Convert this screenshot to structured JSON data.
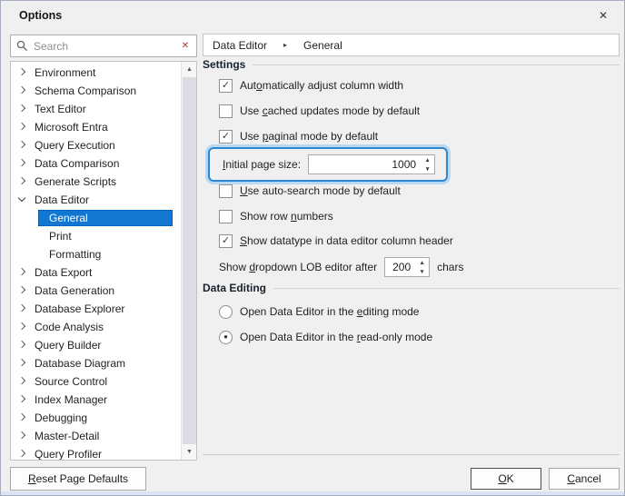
{
  "window": {
    "title": "Options",
    "close_glyph": "✕"
  },
  "search": {
    "placeholder": "Search",
    "clear_glyph": "✕"
  },
  "breadcrumb": {
    "items": [
      "Data Editor",
      "General"
    ],
    "separator_glyph": "▸"
  },
  "tree": {
    "scroll_up_glyph": "▲",
    "scroll_down_glyph": "▼",
    "items": [
      {
        "label": "Environment"
      },
      {
        "label": "Schema Comparison"
      },
      {
        "label": "Text Editor"
      },
      {
        "label": "Microsoft Entra"
      },
      {
        "label": "Query Execution"
      },
      {
        "label": "Data Comparison"
      },
      {
        "label": "Generate Scripts"
      },
      {
        "label": "Data Editor",
        "expanded": true
      },
      {
        "label": "General",
        "selected": true
      },
      {
        "label": "Print"
      },
      {
        "label": "Formatting"
      },
      {
        "label": "Data Export"
      },
      {
        "label": "Data Generation"
      },
      {
        "label": "Database Explorer"
      },
      {
        "label": "Code Analysis"
      },
      {
        "label": "Query Builder"
      },
      {
        "label": "Database Diagram"
      },
      {
        "label": "Source Control"
      },
      {
        "label": "Index Manager"
      },
      {
        "label": "Debugging"
      },
      {
        "label": "Master-Detail"
      },
      {
        "label": "Query Profiler"
      }
    ]
  },
  "settings": {
    "title": "Settings",
    "spin_up_glyph": "▲",
    "spin_down_glyph": "▼",
    "checkboxes": [
      {
        "pre": "Aut",
        "key": "o",
        "post": "matically adjust column width",
        "checked": true,
        "glyph": "✓"
      },
      {
        "pre": "Use ",
        "key": "c",
        "post": "ached updates mode by default",
        "checked": false,
        "glyph": ""
      },
      {
        "pre": "Use ",
        "key": "p",
        "post": "aginal mode by default",
        "checked": true,
        "glyph": "✓"
      },
      {
        "pre": "",
        "key": "U",
        "post": "se auto-search mode by default",
        "checked": false,
        "glyph": ""
      },
      {
        "pre": "Show row ",
        "key": "n",
        "post": "umbers",
        "checked": false,
        "glyph": ""
      },
      {
        "pre": "",
        "key": "S",
        "post": "how datatype in data editor column header",
        "checked": true,
        "glyph": "✓"
      }
    ],
    "initial_page_size": {
      "pre": "",
      "key": "I",
      "post": "nitial page size:",
      "value": "1000"
    },
    "lob": {
      "pre": "Show ",
      "key": "d",
      "post": "ropdown LOB editor after",
      "value": "200",
      "suffix": "chars"
    }
  },
  "data_editing": {
    "title": "Data Editing",
    "radios": [
      {
        "pre": "Open Data Editor in the ",
        "key": "e",
        "post": "diting mode",
        "selected": false,
        "glyph": ""
      },
      {
        "pre": "Open Data Editor in the ",
        "key": "r",
        "post": "ead-only mode",
        "selected": true,
        "glyph": "●"
      }
    ]
  },
  "buttons": {
    "reset": {
      "pre": "",
      "key": "R",
      "post": "eset Page Defaults"
    },
    "ok": {
      "pre": "",
      "key": "O",
      "post": "K"
    },
    "cancel": {
      "pre": "",
      "key": "C",
      "post": "ancel"
    }
  },
  "colors": {
    "selection_blue": "#1177d1",
    "highlight_border": "#2f86d1",
    "highlight_glow": "#b9d8f1",
    "clear_red": "#b3342a"
  }
}
